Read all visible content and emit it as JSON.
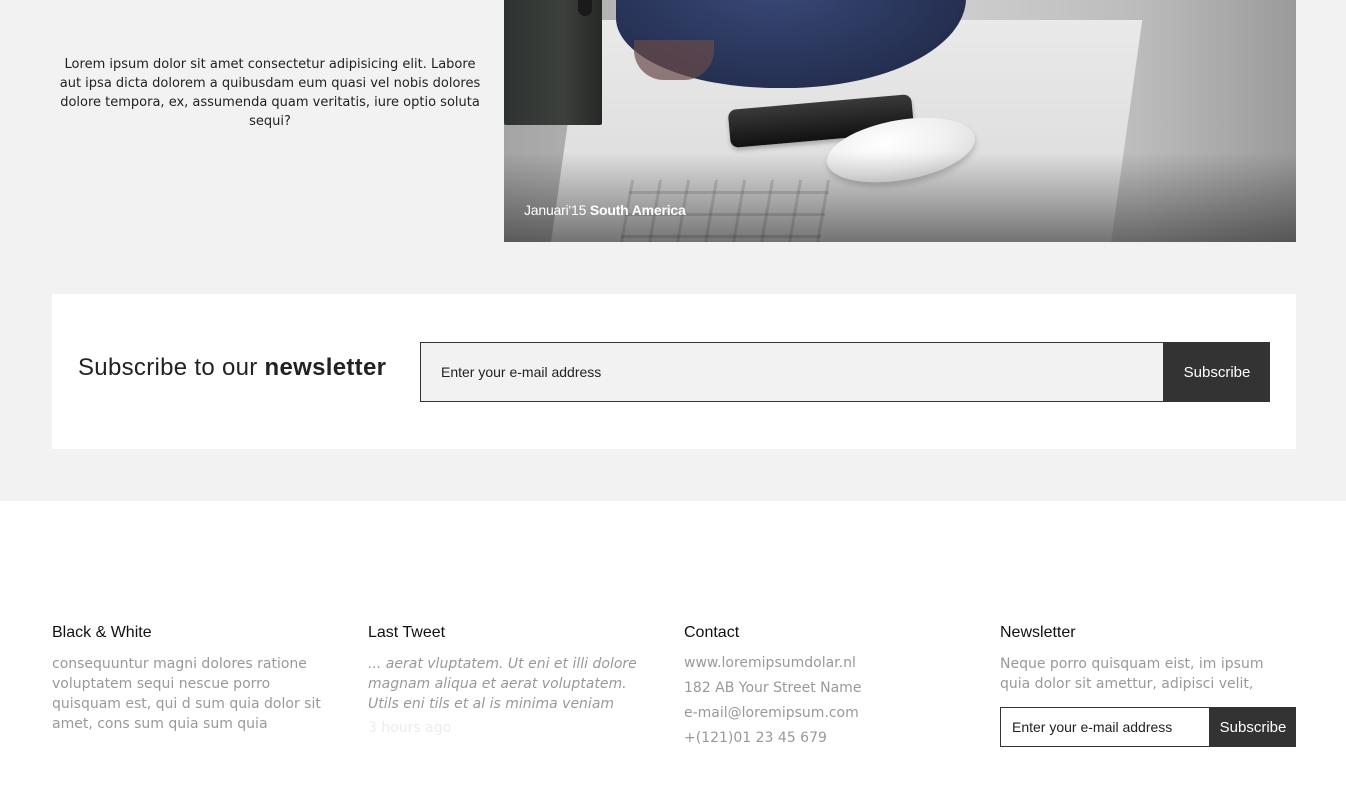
{
  "intro": {
    "text": "Lorem ipsum dolor sit amet consectetur adipisicing elit. Labore aut ipsa dicta dolorem a quibusdam eum quasi vel nobis dolores dolore tempora, ex, assumenda quam veritatis, iure optio soluta sequi?"
  },
  "photo": {
    "caption_date": "Januari'15",
    "caption_place": "South America"
  },
  "subscribe": {
    "title_prefix": "Subscribe to our",
    "title_bold": "newsletter",
    "input_placeholder": "Enter your e-mail address",
    "button_label": "Subscribe"
  },
  "footer": {
    "about": {
      "title": "Black & White",
      "text": "consequuntur magni dolores ratione voluptatem sequi nescue porro quisquam est, qui d sum quia dolor sit amet, cons sum quia sum quia"
    },
    "tweet": {
      "title": "Last Tweet",
      "text": "... aerat vluptatem. Ut eni et illi dolore magnam aliqua et aerat voluptatem. Utils eni tils et al is minima veniam",
      "time": "3 hours ago"
    },
    "contact": {
      "title": "Contact",
      "website": "www.loremipsumdolar.nl",
      "street": "182 AB Your Street Name",
      "email": "e-mail@loremipsum.com",
      "phone": "+(121)01 23 45 679"
    },
    "newsletter": {
      "title": "Newsletter",
      "text": "Neque porro quisquam eist, im ipsum quia dolor sit amettur, adipisci velit,",
      "input_placeholder": "Enter your e-mail address",
      "button_label": "Subscribe"
    }
  }
}
